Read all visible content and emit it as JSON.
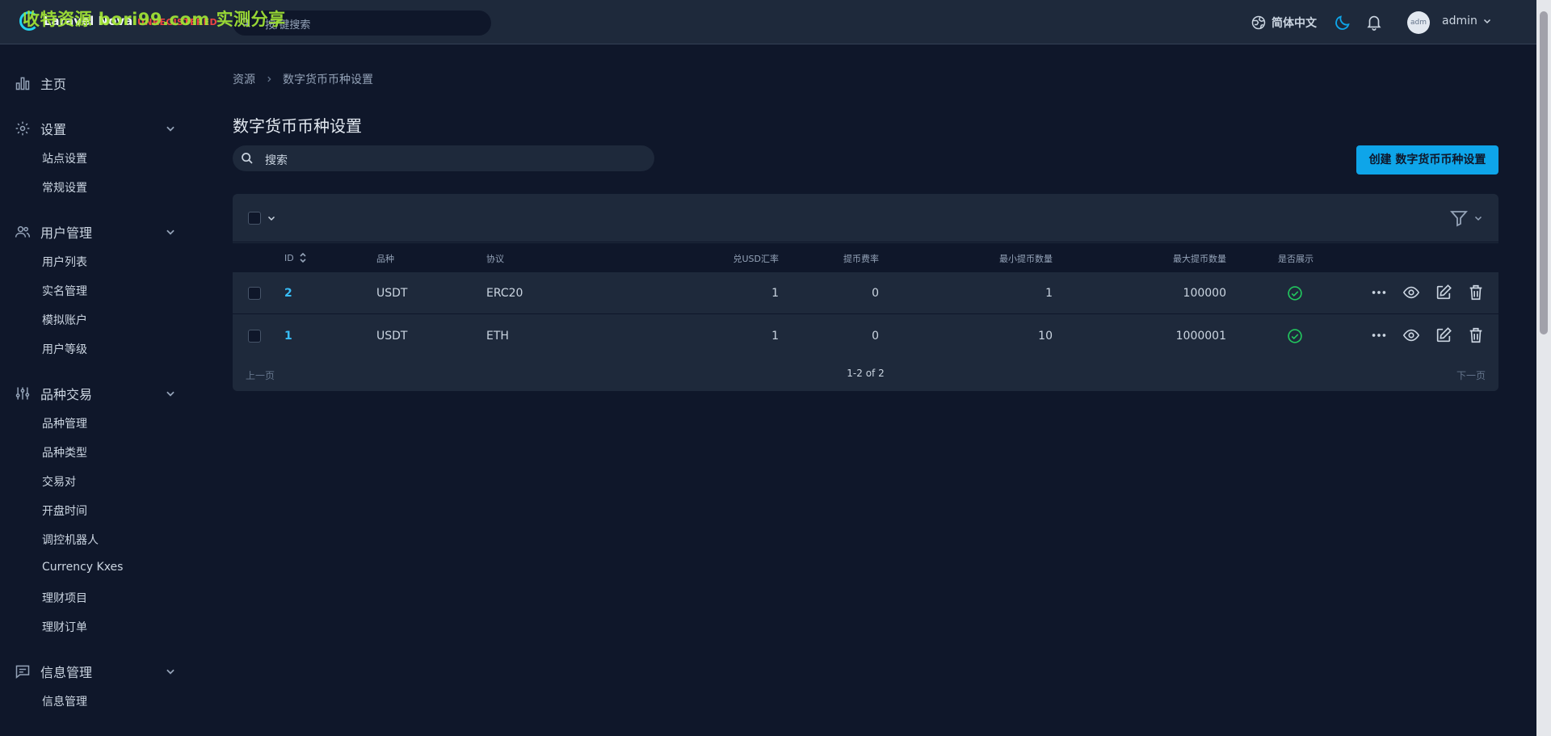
{
  "watermark": "收特资源 bori99.com 实测分享",
  "app": {
    "name": "Laravel Nova",
    "license": "UNREGISTERED"
  },
  "global_search": {
    "placeholder": "按/键搜索"
  },
  "header": {
    "language": "简体中文",
    "user": "admin",
    "avatar_alt": "adm"
  },
  "sidebar": {
    "home": "主页",
    "groups": [
      {
        "label": "设置",
        "items": [
          "站点设置",
          "常规设置"
        ]
      },
      {
        "label": "用户管理",
        "items": [
          "用户列表",
          "实名管理",
          "模拟账户",
          "用户等级"
        ]
      },
      {
        "label": "品种交易",
        "items": [
          "品种管理",
          "品种类型",
          "交易对",
          "开盘时间",
          "调控机器人",
          "Currency Kxes",
          "理财项目",
          "理财订单"
        ]
      },
      {
        "label": "信息管理",
        "items": [
          "信息管理"
        ]
      }
    ]
  },
  "breadcrumb": {
    "root": "资源",
    "current": "数字货币币种设置"
  },
  "page": {
    "title": "数字货币币种设置",
    "search_placeholder": "搜索",
    "create_button": "创建 数字货币币种设置"
  },
  "table": {
    "headers": {
      "id": "ID",
      "symbol": "品种",
      "protocol": "协议",
      "usd_rate": "兑USD汇率",
      "fee_rate": "提币费率",
      "min_withdraw": "最小提币数量",
      "max_withdraw": "最大提币数量",
      "visible": "是否展示"
    },
    "rows": [
      {
        "id": "2",
        "symbol": "USDT",
        "protocol": "ERC20",
        "usd_rate": "1",
        "fee_rate": "0",
        "min_withdraw": "1",
        "max_withdraw": "100000",
        "visible": true
      },
      {
        "id": "1",
        "symbol": "USDT",
        "protocol": "ETH",
        "usd_rate": "1",
        "fee_rate": "0",
        "min_withdraw": "10",
        "max_withdraw": "1000001",
        "visible": true
      }
    ]
  },
  "pagination": {
    "prev": "上一页",
    "info": "1-2 of 2",
    "next": "下一页"
  },
  "colors": {
    "accent": "#0ea5e9",
    "success": "#22c55e",
    "background": "#0f172a",
    "surface": "#1e293b"
  }
}
